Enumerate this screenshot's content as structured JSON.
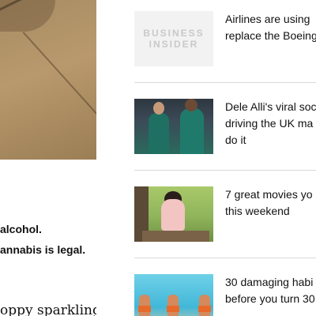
{
  "article": {
    "hero_image": "floor-tile-photo",
    "line_alcohol": "alcohol.",
    "line_cannabis": "annabis is legal.",
    "line_serif": "oppy sparkling"
  },
  "related": {
    "items": [
      {
        "title_line1": "Airlines are using",
        "title_line2": "replace the Boeing",
        "title_line3": "",
        "thumb": "business-insider-logo",
        "logo_line1": "BUSINESS",
        "logo_line2": "INSIDER"
      },
      {
        "title_line1": "Dele Alli's viral soc",
        "title_line2": "driving the UK ma",
        "title_line3": "do it",
        "thumb": "soccer-players-photo"
      },
      {
        "title_line1": "7 great movies yo",
        "title_line2": "this weekend",
        "title_line3": "",
        "thumb": "movie-scene-photo"
      },
      {
        "title_line1": "30 damaging habi",
        "title_line2": "before you turn 30",
        "title_line3": "",
        "thumb": "beach-people-photo"
      }
    ]
  }
}
